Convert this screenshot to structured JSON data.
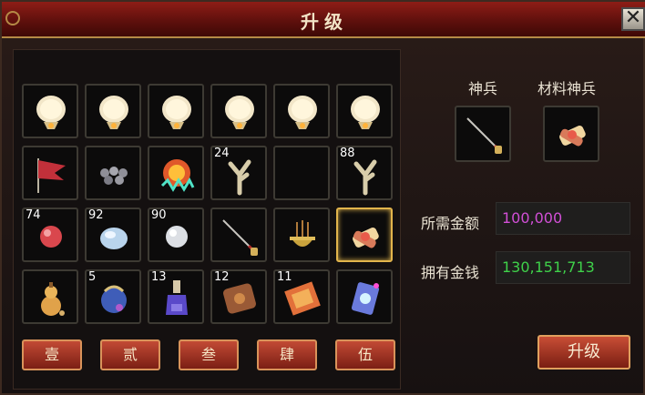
{
  "window": {
    "title": "升级",
    "close_label": "✕"
  },
  "grid": {
    "rows": [
      [
        {
          "icon": "lantern-icon",
          "qty": ""
        },
        {
          "icon": "lantern-icon",
          "qty": ""
        },
        {
          "icon": "lantern-icon",
          "qty": ""
        },
        {
          "icon": "lantern-icon",
          "qty": ""
        },
        {
          "icon": "lantern-icon",
          "qty": ""
        },
        {
          "icon": "lantern-icon",
          "qty": ""
        }
      ],
      [
        {
          "icon": "red-flag-icon",
          "qty": ""
        },
        {
          "icon": "pearls-icon",
          "qty": ""
        },
        {
          "icon": "fire-orb-icon",
          "qty": ""
        },
        {
          "icon": "coral-icon",
          "qty": "24"
        },
        {
          "icon": "empty-slot",
          "qty": ""
        },
        {
          "icon": "coral-icon",
          "qty": "88"
        }
      ],
      [
        {
          "icon": "red-orb-icon",
          "qty": "74"
        },
        {
          "icon": "blue-gem-icon",
          "qty": "92"
        },
        {
          "icon": "white-pearl-icon",
          "qty": "90"
        },
        {
          "icon": "spear-icon",
          "qty": ""
        },
        {
          "icon": "incense-burner-icon",
          "qty": ""
        },
        {
          "icon": "scroll-bundle-icon",
          "qty": ""
        }
      ],
      [
        {
          "icon": "gourd-icon",
          "qty": ""
        },
        {
          "icon": "blue-bag-icon",
          "qty": "5"
        },
        {
          "icon": "potion-icon",
          "qty": "13"
        },
        {
          "icon": "leather-scroll-icon",
          "qty": "12"
        },
        {
          "icon": "red-scroll-icon",
          "qty": "11"
        },
        {
          "icon": "rune-card-icon",
          "qty": ""
        }
      ]
    ]
  },
  "tabs": [
    "壹",
    "贰",
    "叁",
    "肆",
    "伍"
  ],
  "equipment": {
    "weapon_label": "神兵",
    "material_label": "材料神兵"
  },
  "cost": {
    "label": "所需金额",
    "value": "100,000",
    "color": "#d14fd6"
  },
  "money": {
    "label": "拥有金钱",
    "value": "130,151,713",
    "color": "#3fd14a"
  },
  "actions": {
    "upgrade_label": "升级"
  }
}
